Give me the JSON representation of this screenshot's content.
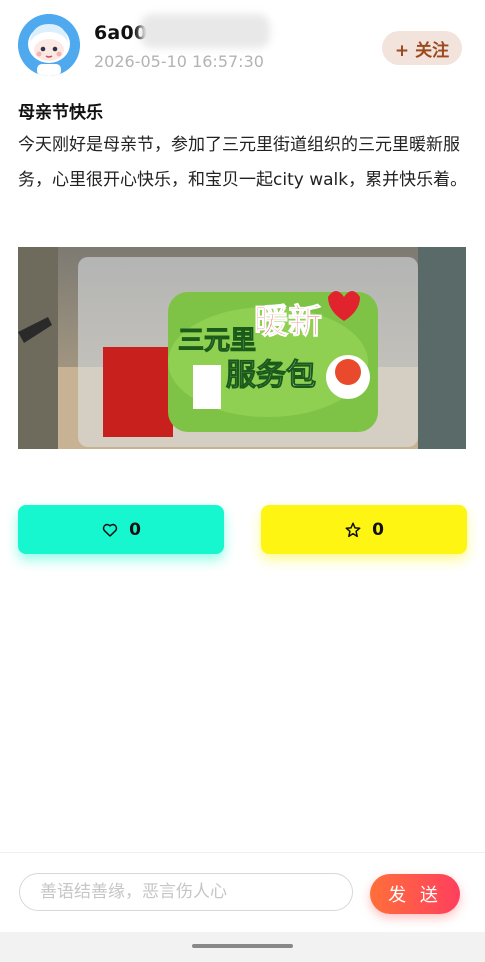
{
  "header": {
    "username": "6a00",
    "timestamp": "2026-05-10 16:57:30",
    "follow_label": "+ 关注"
  },
  "post": {
    "title": "母亲节快乐",
    "body": "今天刚好是母亲节，参加了三元里街道组织的三元里暖新服务，心里很开心快乐，和宝贝一起city walk，累并快乐着。",
    "image_text": {
      "line1": "三元里",
      "highlight": "暖新",
      "line2": "服务包"
    }
  },
  "actions": {
    "like_count": "0",
    "favorite_count": "0"
  },
  "comment": {
    "placeholder": "善语结善缘，恶言伤人心",
    "send_label": "发 送"
  },
  "colors": {
    "like_button": "#17f7cf",
    "favorite_button": "#fff512",
    "follow_text": "#9a4a1e",
    "send_gradient_start": "#ff6f3a",
    "send_gradient_end": "#ff3f5e"
  },
  "icons": {
    "like": "heart-icon",
    "favorite": "star-icon"
  }
}
